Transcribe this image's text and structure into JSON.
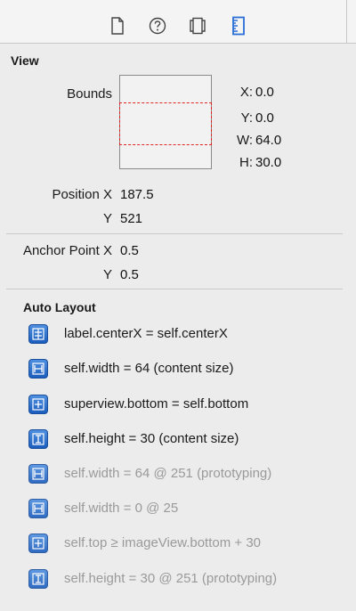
{
  "toolbar": {
    "icons": [
      "file-icon",
      "help-icon",
      "identity-icon",
      "ruler-icon"
    ]
  },
  "view": {
    "section_title": "View",
    "bounds_label": "Bounds",
    "x_label": "X:",
    "x_value": "0.0",
    "y_label": "Y:",
    "y_value": "0.0",
    "w_label": "W:",
    "w_value": "64.0",
    "h_label": "H:",
    "h_value": "30.0",
    "position_x_label": "Position X",
    "position_x_value": "187.5",
    "position_y_label": "Y",
    "position_y_value": "521",
    "anchor_x_label": "Anchor Point X",
    "anchor_x_value": "0.5",
    "anchor_y_label": "Y",
    "anchor_y_value": "0.5"
  },
  "auto_layout": {
    "title": "Auto Layout",
    "constraints": [
      {
        "text": "label.centerX = self.centerX",
        "icon": "center-x-icon",
        "dimmed": false
      },
      {
        "text": "self.width = 64 (content size)",
        "icon": "width-constraint-icon",
        "dimmed": false
      },
      {
        "text": "superview.bottom = self.bottom",
        "icon": "position-constraint-icon",
        "dimmed": false
      },
      {
        "text": "self.height = 30 (content size)",
        "icon": "height-constraint-icon",
        "dimmed": false
      },
      {
        "text": "self.width = 64 @ 251 (prototyping)",
        "icon": "width-constraint-icon",
        "dimmed": true
      },
      {
        "text": "self.width = 0 @ 25",
        "icon": "width-constraint-icon",
        "dimmed": true
      },
      {
        "text": "self.top ≥ imageView.bottom + 30",
        "icon": "position-constraint-icon",
        "dimmed": true
      },
      {
        "text": "self.height = 30 @ 251 (prototyping)",
        "icon": "height-constraint-icon",
        "dimmed": true
      }
    ]
  },
  "colors": {
    "accent": "#2a6fd6",
    "bounds_dash": "#e02424",
    "dim_text": "#9a9a9a"
  }
}
